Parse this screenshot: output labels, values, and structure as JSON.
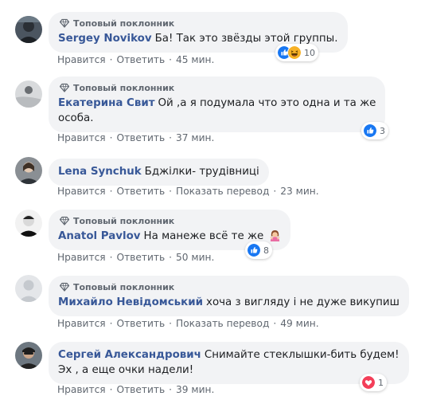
{
  "comments": [
    {
      "badge": "Топовый поклонник",
      "author": "Sergey Novikov",
      "lines": [
        "Ба! Так это звёзды этой группы."
      ],
      "actions": {
        "like": "Нравится",
        "reply": "Ответить",
        "time": "45 мин."
      },
      "reactions": {
        "icons": [
          "like-icon",
          "haha-icon"
        ],
        "count": "10"
      }
    },
    {
      "badge": "Топовый поклонник",
      "author": "Екатерина Свит",
      "lines": [
        "Ой ,а я подумала что это одна и та же",
        "особа."
      ],
      "actions": {
        "like": "Нравится",
        "reply": "Ответить",
        "time": "37 мин."
      },
      "reactions": {
        "icons": [
          "like-icon"
        ],
        "count": "3"
      }
    },
    {
      "author": "Lena Synchuk",
      "lines": [
        "Бджілки- трудівниці"
      ],
      "actions": {
        "like": "Нравится",
        "reply": "Ответить",
        "translate": "Показать перевод",
        "time": "23 мин."
      }
    },
    {
      "badge": "Топовый поклонник",
      "author": "Anatol Pavlov",
      "lines": [
        "На манеже всё те же"
      ],
      "emoji": "woman-gesturing-icon",
      "actions": {
        "like": "Нравится",
        "reply": "Ответить",
        "time": "50 мин."
      },
      "reactions": {
        "icons": [
          "like-icon"
        ],
        "count": "8"
      }
    },
    {
      "badge": "Топовый поклонник",
      "author": "Михайло Невідомський",
      "lines": [
        "хоча з вигляду і не дуже викупиш"
      ],
      "actions": {
        "like": "Нравится",
        "reply": "Ответить",
        "translate": "Показать перевод",
        "time": "49 мин."
      }
    },
    {
      "author": "Сергей Александрович",
      "lines": [
        "Снимайте стеклышки-бить будем!",
        "Эх , а еще очки надели!"
      ],
      "actions": {
        "like": "Нравится",
        "reply": "Ответить",
        "time": "39 мин."
      },
      "reactions": {
        "icons": [
          "love-icon"
        ],
        "count": "1"
      }
    }
  ],
  "colors": {
    "author": "#385898",
    "bubble": "#f2f3f5",
    "meta": "#606770",
    "like": "#1877f2",
    "love": "#f33e58",
    "haha": "#f7b125"
  }
}
